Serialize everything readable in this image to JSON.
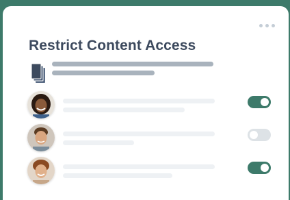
{
  "header": {
    "title": "Restrict Content Access",
    "menu_icon": "more-horizontal-icon"
  },
  "document": {
    "icon": "documents-icon"
  },
  "users": [
    {
      "avatar": "user-avatar-1",
      "access_enabled": true
    },
    {
      "avatar": "user-avatar-2",
      "access_enabled": false
    },
    {
      "avatar": "user-avatar-3",
      "access_enabled": true
    }
  ],
  "colors": {
    "background": "#3d7a6a",
    "toggle_on": "#3d7a6a",
    "toggle_off": "#dde2e6",
    "title": "#3d4a5e"
  }
}
